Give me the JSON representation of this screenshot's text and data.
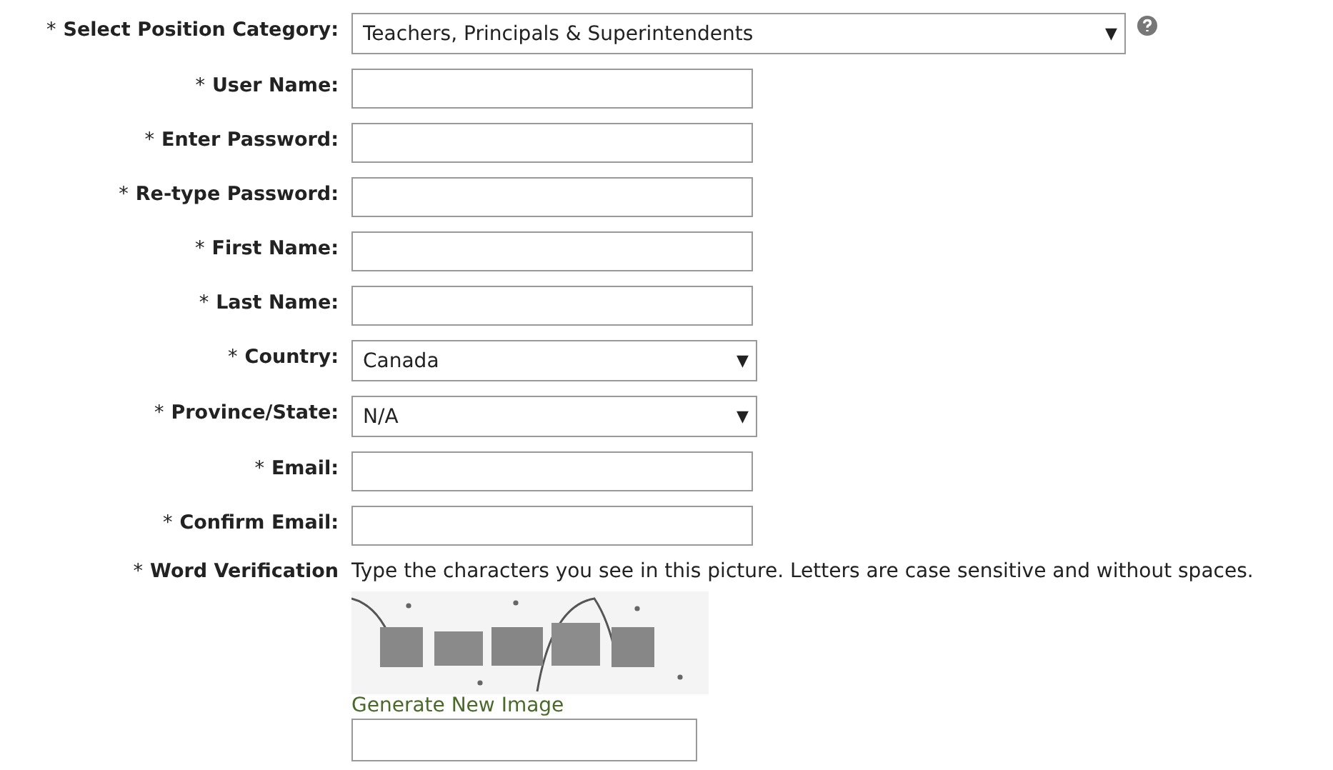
{
  "fields": [
    {
      "kind": "select",
      "required_mark": "*",
      "label": "Select Position Category:",
      "value": "Teachers, Principals & Superintendents",
      "arrow": "▼",
      "wide": true,
      "help": true
    },
    {
      "kind": "text",
      "required_mark": "*",
      "label": "User Name:"
    },
    {
      "kind": "text",
      "required_mark": "*",
      "label": "Enter Password:"
    },
    {
      "kind": "text",
      "required_mark": "*",
      "label": "Re-type Password:"
    },
    {
      "kind": "text",
      "required_mark": "*",
      "label": "First Name:"
    },
    {
      "kind": "text",
      "required_mark": "*",
      "label": "Last Name:"
    },
    {
      "kind": "select",
      "required_mark": "*",
      "label": "Country:",
      "value": "Canada",
      "arrow": "▼",
      "wide": false,
      "help": false
    },
    {
      "kind": "select",
      "required_mark": "*",
      "label": "Province/State:",
      "value": "N/A",
      "arrow": "▼",
      "wide": false,
      "help": false
    },
    {
      "kind": "text",
      "required_mark": "*",
      "label": "Email:"
    },
    {
      "kind": "text",
      "required_mark": "*",
      "label": "Confirm Email:"
    },
    {
      "kind": "verification",
      "required_mark": "*",
      "label": "Word Verification",
      "instructions": "Type the characters you see in this picture. Letters are case sensitive and without spaces.",
      "link": "Generate New Image"
    }
  ]
}
